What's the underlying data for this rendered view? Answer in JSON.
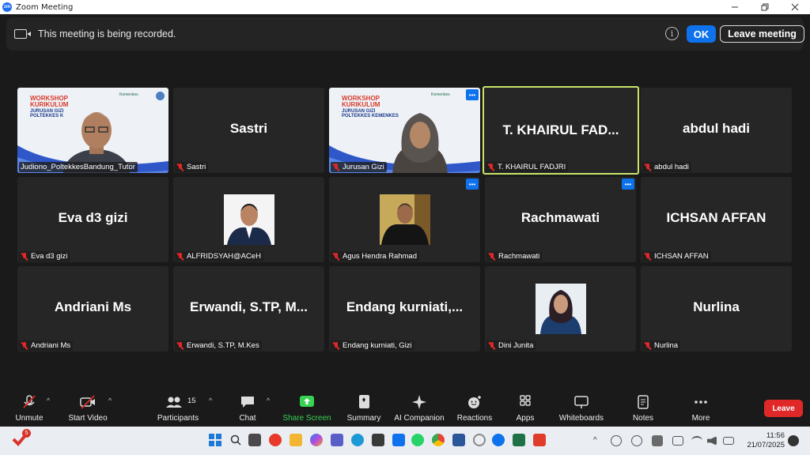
{
  "window": {
    "title": "Zoom Meeting",
    "app_logo": "zm"
  },
  "banner": {
    "text": "This meeting is being recorded.",
    "info_symbol": "i",
    "ok_label": "OK",
    "leave_meeting_label": "Leave meeting"
  },
  "tiles": [
    {
      "label": "Judiono_PoltekkesBandung_Tutor",
      "display": ""
    },
    {
      "label": "Sastri",
      "display": "Sastri"
    },
    {
      "label": "Jurusan Gizi",
      "display": ""
    },
    {
      "label": "T. KHAIRUL FADJRI",
      "display": "T.  KHAIRUL  FAD..."
    },
    {
      "label": "abdul hadi",
      "display": "abdul hadi"
    },
    {
      "label": "Eva d3 gizi",
      "display": "Eva d3 gizi"
    },
    {
      "label": "ALFRIDSYAH@ACeH",
      "display": ""
    },
    {
      "label": "Agus Hendra Rahmad",
      "display": ""
    },
    {
      "label": "Rachmawati",
      "display": "Rachmawati"
    },
    {
      "label": "ICHSAN AFFAN",
      "display": "ICHSAN AFFAN"
    },
    {
      "label": "Andriani Ms",
      "display": "Andriani Ms"
    },
    {
      "label": "Erwandi, S.TP, M.Kes",
      "display": "Erwandi,  S.TP,  M..."
    },
    {
      "label": "Endang kurniati, Gizi",
      "display": "Endang  kurniati,..."
    },
    {
      "label": "Dini Junita",
      "display": ""
    },
    {
      "label": "Nurlina",
      "display": "Nurlina"
    }
  ],
  "slide": {
    "title_line1": "WORKSHOP",
    "title_line2": "KURIKULUM",
    "sub_line1": "JURUSAN GIZI",
    "sub_line2_a": "POLTEKKES K",
    "sub_line2_b": "POLTEKKES KEMENKES",
    "logo_text": "Kemenkes"
  },
  "toolbar": {
    "unmute": "Unmute",
    "start_video": "Start Video",
    "participants": "Participants",
    "participants_count": "15",
    "chat": "Chat",
    "share_screen": "Share Screen",
    "summary": "Summary",
    "ai_companion": "AI Companion",
    "reactions": "Reactions",
    "apps": "Apps",
    "whiteboards": "Whiteboards",
    "notes": "Notes",
    "more": "More",
    "leave": "Leave"
  },
  "taskbar": {
    "badge": "5",
    "time": "11:56",
    "date": "21/07/2025",
    "tray_caret": "^"
  },
  "colors": {
    "accent": "#0e72ed",
    "danger": "#e02828",
    "active_speaker": "#c9e36b",
    "share_green": "#39d353"
  }
}
